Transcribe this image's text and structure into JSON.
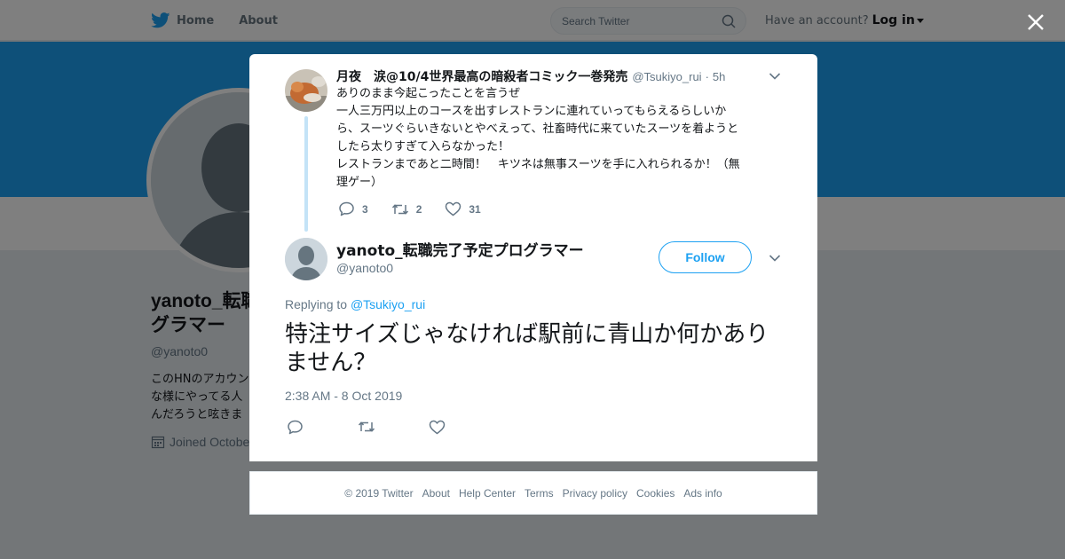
{
  "colors": {
    "brand": "#1da1f2",
    "text": "#14171a",
    "muted": "#657786",
    "background": "#e6ecf0"
  },
  "nav": {
    "home": "Home",
    "about": "About",
    "search_placeholder": "Search Twitter",
    "have_account": "Have an account?",
    "login": "Log in"
  },
  "profile": {
    "name_line1": "yanoto_転職",
    "name_line2": "グラマー",
    "handle": "@yanoto0",
    "bio_lines": [
      "このHNのアカウン",
      "な様にやってる人",
      "んだろうと呟きま"
    ],
    "joined": "Joined Octobe"
  },
  "ancestor": {
    "name": "月夜　涙@10/4世界最高の暗殺者コミック一巻発売",
    "handle": "@Tsukiyo_rui",
    "dot": "·",
    "time": "5h",
    "text_lines": [
      "ありのまま今起こったことを言うぜ",
      "一人三万円以上のコースを出すレストランに連れていってもらえるらしいか",
      "ら、スーツぐらいきないとやべえって、社畜時代に来ていたスーツを着ようと",
      "したら太りすぎて入らなかった！",
      "レストランまであと二時間！　キツネは無事スーツを手に入れられるか！（無",
      "理ゲー）"
    ],
    "replies": "3",
    "retweets": "2",
    "likes": "31"
  },
  "tweet": {
    "name": "yanoto_転職完了予定プログラマー",
    "handle": "@yanoto0",
    "follow": "Follow",
    "replying_prefix": "Replying to",
    "replying_to": "@Tsukiyo_rui",
    "text": "特注サイズじゃなければ駅前に青山か何かありません？",
    "timestamp": "2:38 AM - 8 Oct 2019"
  },
  "footer": {
    "copyright": "© 2019 Twitter",
    "links": [
      "About",
      "Help Center",
      "Terms",
      "Privacy policy",
      "Cookies",
      "Ads info"
    ]
  },
  "icons": {
    "logo": "twitter-bird-icon",
    "search": "search-icon",
    "close": "close-icon",
    "calendar": "calendar-icon",
    "reply": "reply-icon",
    "retweet": "retweet-icon",
    "like": "heart-icon",
    "menu": "chevron-down-icon"
  }
}
